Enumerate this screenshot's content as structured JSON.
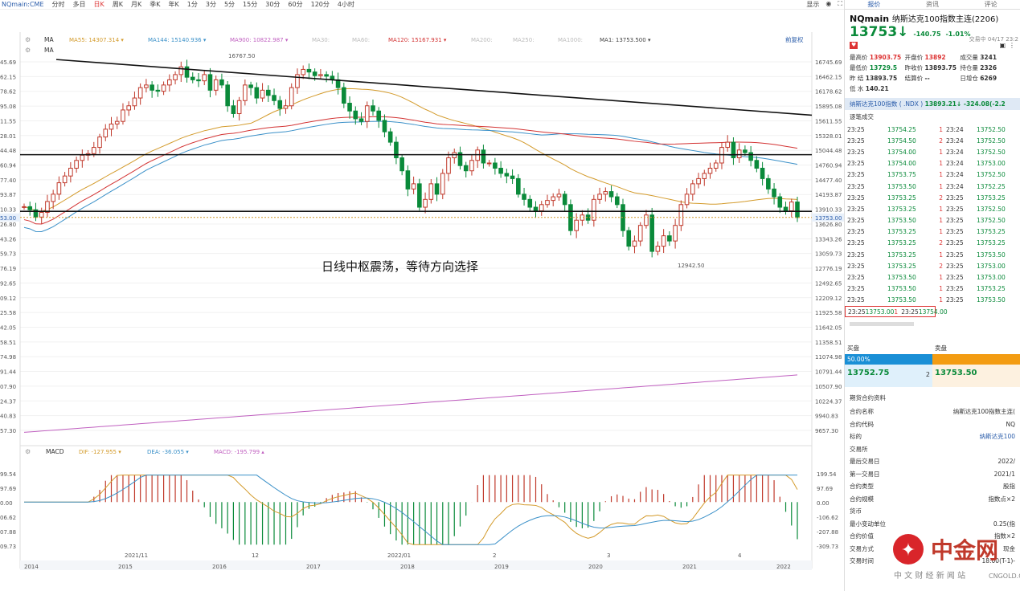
{
  "toolbar": {
    "symbol": "NQmain:CME",
    "periods": [
      "分时",
      "多日",
      "日K",
      "周K",
      "月K",
      "季K",
      "年K",
      "1分",
      "3分",
      "5分",
      "15分",
      "30分",
      "60分",
      "120分",
      "4小时"
    ],
    "selected": "日K",
    "right": [
      "显示"
    ]
  },
  "ma_legend": {
    "label": "MA",
    "items": [
      {
        "t": "MA55: 14307.314",
        "c": "#d39a2a"
      },
      {
        "t": "MA144: 15140.936",
        "c": "#3a90c8"
      },
      {
        "t": "MA900: 10822.987",
        "c": "#c060c0"
      },
      {
        "t": "MA30:",
        "c": "#bbbbbb"
      },
      {
        "t": "MA60:",
        "c": "#bbbbbb"
      },
      {
        "t": "MA120: 15167.931",
        "c": "#d33333"
      },
      {
        "t": "MA200:",
        "c": "#bbbbbb"
      },
      {
        "t": "MA250:",
        "c": "#bbbbbb"
      },
      {
        "t": "MA1000:",
        "c": "#bbbbbb"
      },
      {
        "t": "MA1: 13753.500",
        "c": "#444444"
      }
    ],
    "adjust": "前复权",
    "ma2": "MA"
  },
  "price_axis": {
    "right_ticks": [
      "16745.69",
      "16462.15",
      "16178.62",
      "15895.08",
      "15611.55",
      "15328.01",
      "15044.48",
      "14760.94",
      "14477.40",
      "14193.87",
      "13910.33",
      "13626.80",
      "13343.26",
      "13059.73",
      "12776.19",
      "12492.65",
      "12209.12",
      "11925.58",
      "11642.05",
      "11358.51",
      "11074.98",
      "10791.44",
      "10507.90",
      "10224.37",
      "9940.83",
      "9657.30"
    ],
    "left_ticks": [
      "45.69",
      "62.15",
      "78.62",
      "95.08",
      "11.55",
      "28.01",
      "44.48",
      "60.94",
      "77.40",
      "93.87",
      "10.33",
      "26.80",
      "43.26",
      "59.73",
      "76.19",
      "92.65",
      "09.12",
      "25.58",
      "42.05",
      "58.51",
      "74.98",
      "91.44",
      "07.90",
      "24.37",
      "40.83",
      "57.30"
    ],
    "last_price": "13753.00",
    "last_price_left": "53.00"
  },
  "annotations": {
    "high_label": "16767.50",
    "low_label": "12942.50",
    "note": "日线中枢震荡，等待方向选择"
  },
  "macd": {
    "label": "MACD",
    "dif": "DIF: -127.955",
    "dea": "DEA: -36.055",
    "macd": "MACD: -195.799",
    "right_ticks": [
      "199.54",
      "97.69",
      "0.00",
      "-106.62",
      "-207.88",
      "-309.73"
    ],
    "left_ticks": [
      "99.54",
      "97.69",
      "0.00",
      "06.62",
      "07.88",
      "09.73"
    ]
  },
  "time_axis": {
    "labels": [
      "2021/11",
      "12",
      "2022/01",
      "2",
      "3",
      "4"
    ],
    "bottom": [
      "2014",
      "2015",
      "2016",
      "2017",
      "2018",
      "2019",
      "2020",
      "2021",
      "2022"
    ]
  },
  "chart_data": {
    "type": "candlestick",
    "series": [
      {
        "name": "NQmain",
        "ohlc_note": "daily"
      }
    ],
    "range": {
      "y": [
        9657.3,
        16745.69
      ]
    },
    "last": 13753.0,
    "trendlines": [
      "descending resistance",
      "14950 horizontal",
      "13880 horizontal"
    ]
  },
  "right": {
    "tabs": [
      "报价",
      "资讯",
      "评论"
    ],
    "name": "NQmain",
    "cname": "纳斯达克100指数主连(2206)",
    "price": "13753",
    "arrow": "↓",
    "chg": "-140.75",
    "pct": "-1.01%",
    "status": "交易中 04/17 23:2",
    "stats": [
      [
        "最高价",
        "13903.75",
        "red"
      ],
      [
        "开盘价",
        "13892",
        "red"
      ],
      [
        "成交量",
        "3241",
        ""
      ],
      [
        "最低价",
        "13729.5",
        "grn"
      ],
      [
        "昨收价",
        "13893.75",
        ""
      ],
      [
        "持仓量",
        "2326",
        ""
      ],
      [
        "昨 结",
        "13893.75",
        ""
      ],
      [
        "结算价",
        "--",
        ""
      ],
      [
        "日增仓",
        "6269",
        ""
      ],
      [
        "低 水",
        "140.21",
        ""
      ]
    ],
    "index_row": "纳斯达克100指数 ( .NDX )",
    "index_val": "13893.21↓ -324.08(-2.2",
    "trades_title": "逐笔成交",
    "trades": [
      [
        "23:25",
        "13754.25",
        "1",
        "23:24",
        "13752.50"
      ],
      [
        "23:25",
        "13754.50",
        "2",
        "23:24",
        "13752.50"
      ],
      [
        "23:25",
        "13754.00",
        "1",
        "23:24",
        "13752.50"
      ],
      [
        "23:25",
        "13754.00",
        "1",
        "23:24",
        "13753.00"
      ],
      [
        "23:25",
        "13753.75",
        "1",
        "23:24",
        "13752.50"
      ],
      [
        "23:25",
        "13753.50",
        "1",
        "23:24",
        "13752.25"
      ],
      [
        "23:25",
        "13753.25",
        "2",
        "23:25",
        "13753.25"
      ],
      [
        "23:25",
        "13753.25",
        "1",
        "23:25",
        "13752.50"
      ],
      [
        "23:25",
        "13753.50",
        "1",
        "23:25",
        "13752.50"
      ],
      [
        "23:25",
        "13753.25",
        "1",
        "23:25",
        "13753.25"
      ],
      [
        "23:25",
        "13753.25",
        "2",
        "23:25",
        "13753.25"
      ],
      [
        "23:25",
        "13753.25",
        "1",
        "23:25",
        "13753.50"
      ],
      [
        "23:25",
        "13753.25",
        "2",
        "23:25",
        "13753.00"
      ],
      [
        "23:25",
        "13753.50",
        "1",
        "23:25",
        "13753.00"
      ],
      [
        "23:25",
        "13753.50",
        "1",
        "23:25",
        "13753.25"
      ],
      [
        "23:25",
        "13753.50",
        "1",
        "23:25",
        "13753.50"
      ],
      [
        "23:25",
        "13753.00",
        "1",
        "23:25",
        "13754.00"
      ]
    ],
    "buy": "买盘",
    "sell": "卖盘",
    "buy_pct": "50.00%",
    "bid": "13752.75",
    "bid_qty": "2",
    "ask": "13753.50",
    "info_title": "期货合约资料",
    "info": [
      [
        "合约名称",
        "纳斯达克100指数主连("
      ],
      [
        "合约代码",
        "NQ"
      ],
      [
        "标的",
        "纳斯达克100"
      ],
      [
        "交易所",
        ""
      ],
      [
        "最后交易日",
        "2022/"
      ],
      [
        "第一交易日",
        "2021/1"
      ],
      [
        "合约类型",
        "股指"
      ],
      [
        "合约规模",
        "指数点×2"
      ],
      [
        "货币",
        ""
      ],
      [
        "最小变动单位",
        "0.25(指"
      ],
      [
        "合约价值",
        "指数×2"
      ],
      [
        "交易方式",
        "现金"
      ],
      [
        "交易时间",
        "18:00(T-1)-"
      ]
    ]
  },
  "watermark": {
    "big": "中金网",
    "small": "中 文 财 经 新 闻 站",
    "url": "CNGOLD.COM"
  }
}
